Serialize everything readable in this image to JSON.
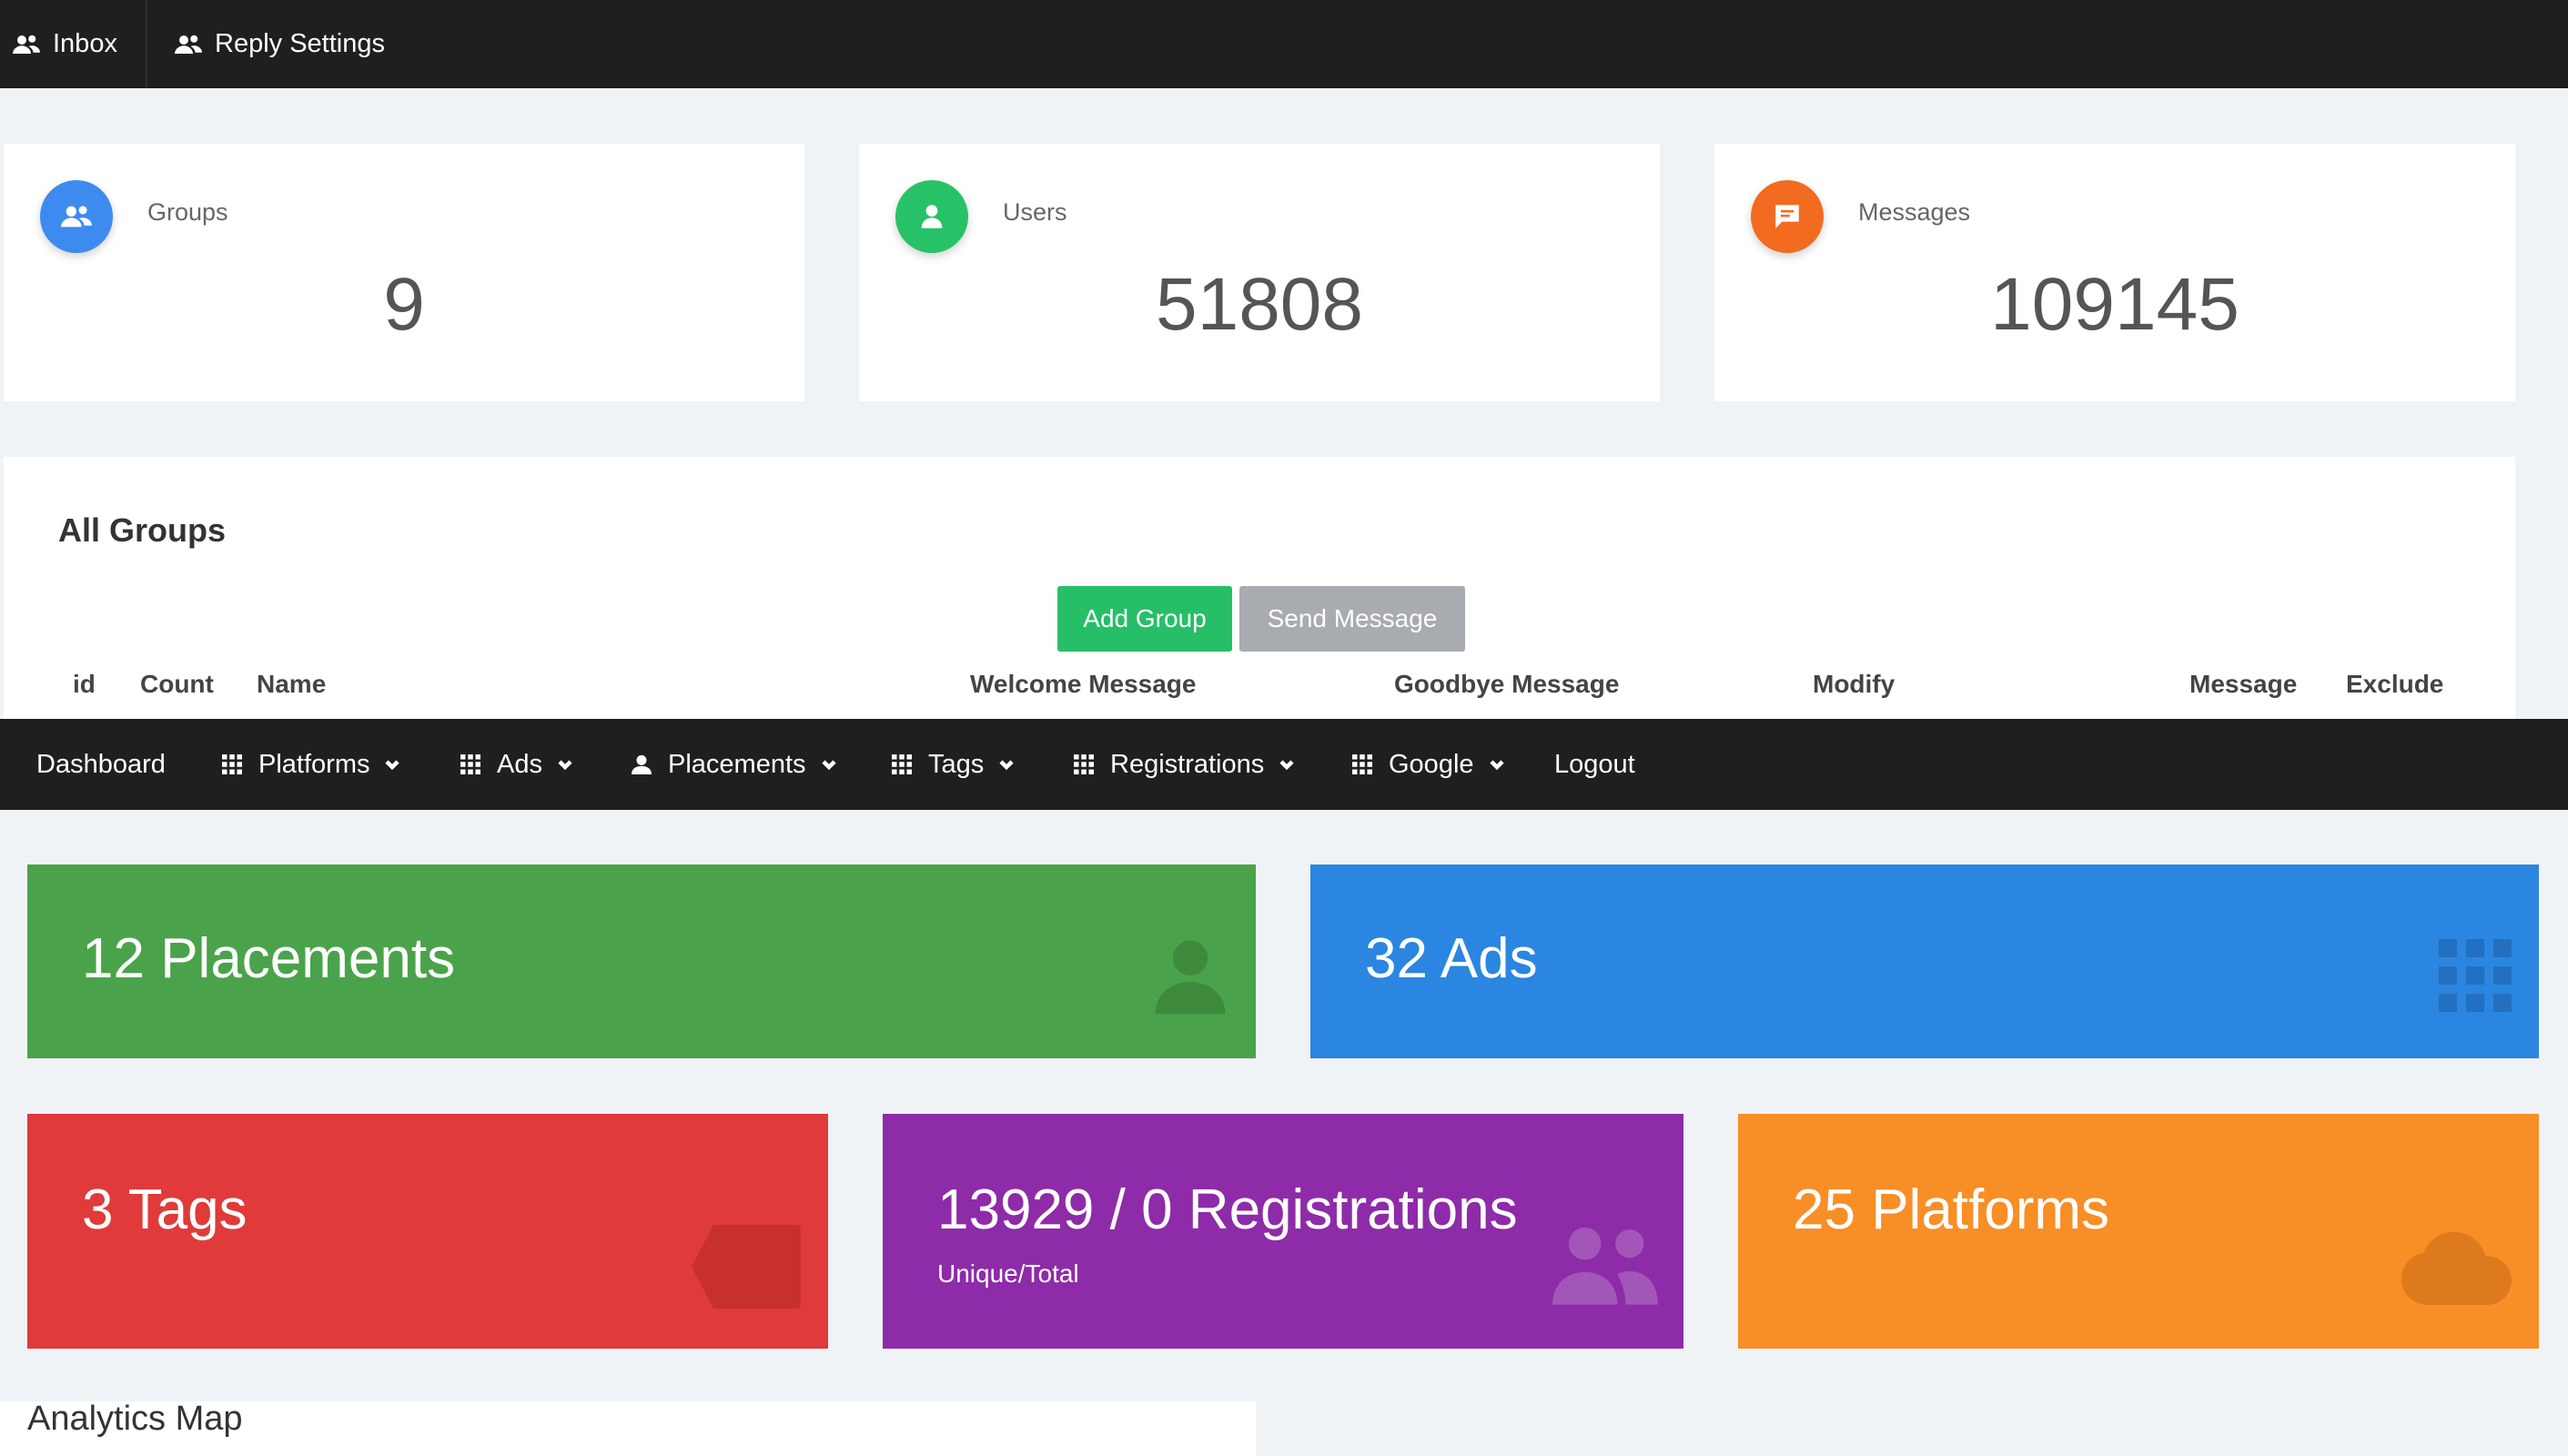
{
  "topnav": {
    "items": [
      {
        "label": "Inbox",
        "icon": "users-icon"
      },
      {
        "label": "Reply Settings",
        "icon": "users-icon"
      }
    ]
  },
  "stats": [
    {
      "label": "Groups",
      "value": "9",
      "icon": "group-icon",
      "color": "#3d8bef"
    },
    {
      "label": "Users",
      "value": "51808",
      "icon": "user-icon",
      "color": "#27c267"
    },
    {
      "label": "Messages",
      "value": "109145",
      "icon": "chat-icon",
      "color": "#f26b21"
    }
  ],
  "groups": {
    "title": "All Groups",
    "add_label": "Add Group",
    "send_label": "Send Message",
    "columns": [
      "id",
      "Count",
      "Name",
      "Welcome Message",
      "Goodbye Message",
      "Modify",
      "Message",
      "Exclude"
    ]
  },
  "nav2": {
    "items": [
      {
        "label": "Dashboard",
        "icon": "",
        "dropdown": false
      },
      {
        "label": "Platforms",
        "icon": "grid-icon",
        "dropdown": true
      },
      {
        "label": "Ads",
        "icon": "grid-icon",
        "dropdown": true
      },
      {
        "label": "Placements",
        "icon": "person-icon",
        "dropdown": true
      },
      {
        "label": "Tags",
        "icon": "grid-icon",
        "dropdown": true
      },
      {
        "label": "Registrations",
        "icon": "grid-icon",
        "dropdown": true
      },
      {
        "label": "Google",
        "icon": "grid-icon",
        "dropdown": true
      },
      {
        "label": "Logout",
        "icon": "",
        "dropdown": false
      }
    ]
  },
  "boxes": {
    "placements": {
      "text": "12 Placements",
      "color": "#4aa34a"
    },
    "ads": {
      "text": "32 Ads",
      "color": "#2a86e0"
    },
    "tags": {
      "text": "3 Tags",
      "color": "#e03a3a"
    },
    "registrations": {
      "text": "13929 / 0 Registrations",
      "sub": "Unique/Total",
      "color": "#8e2ba8"
    },
    "platforms": {
      "text": "25 Platforms",
      "color": "#f88e26"
    }
  },
  "analytics": {
    "title": "Analytics Map"
  }
}
